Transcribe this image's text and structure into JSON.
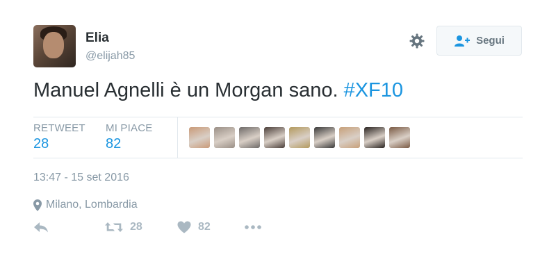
{
  "tweet": {
    "author_name": "Elia",
    "author_handle": "@elijah85",
    "follow_label": "Segui",
    "text": "Manuel Agnelli è un Morgan sano.",
    "hashtag": "#XF10",
    "stats": {
      "retweet_label": "RETWEET",
      "retweet_count": "28",
      "likes_label": "MI PIACE",
      "likes_count": "82"
    },
    "timestamp": "13:47 - 15 set 2016",
    "location": "Milano, Lombardia",
    "actions": {
      "retweet_count": "28",
      "like_count": "82"
    }
  },
  "icons": {
    "settings": "gear-icon",
    "follow": "add-user-icon",
    "location": "location-pin-icon",
    "reply": "reply-icon",
    "retweet": "retweet-icon",
    "like": "heart-icon",
    "more": "more-icon"
  },
  "likers": [
    {
      "color": "#c99a78"
    },
    {
      "color": "#9a8f86"
    },
    {
      "color": "#6e6a68"
    },
    {
      "color": "#4b3f3a"
    },
    {
      "color": "#b39a5e"
    },
    {
      "color": "#3a3a3a"
    },
    {
      "color": "#c7a07a"
    },
    {
      "color": "#2a2421"
    },
    {
      "color": "#7a5a44"
    }
  ],
  "colors": {
    "link": "#1b95e0",
    "muted": "#8899a6",
    "action": "#aab8c2",
    "text": "#292f33"
  }
}
